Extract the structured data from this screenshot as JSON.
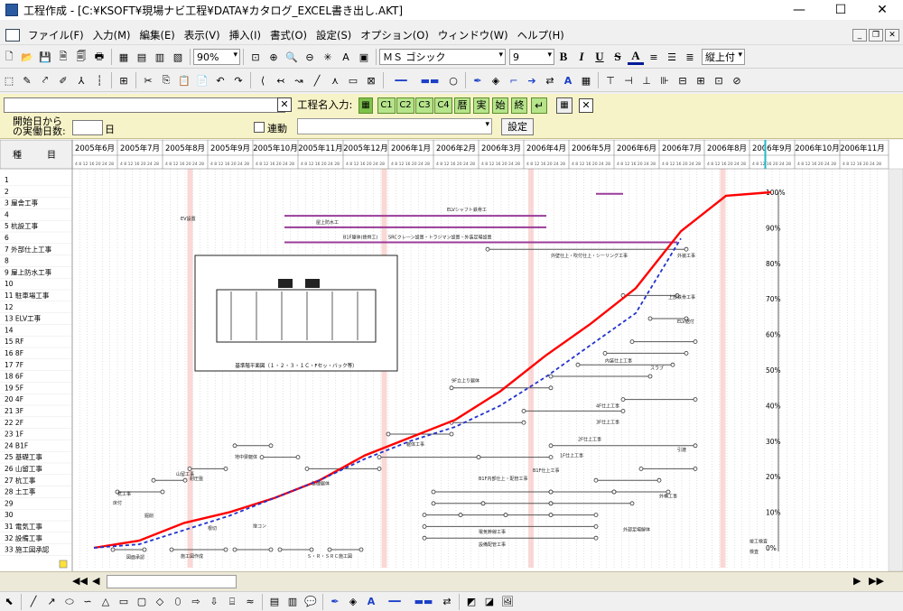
{
  "window": {
    "title": "工程作成 - [C:¥KSOFT¥現場ナビ工程¥DATA¥カタログ_EXCEL書き出し.AKT]",
    "min_icon": "minimize-icon",
    "max_icon": "maximize-icon",
    "close_icon": "close-icon"
  },
  "menu": {
    "items": [
      "ファイル(F)",
      "入力(M)",
      "編集(E)",
      "表示(V)",
      "挿入(I)",
      "書式(O)",
      "設定(S)",
      "オプション(O)",
      "ウィンドウ(W)",
      "ヘルプ(H)"
    ],
    "mdi_buttons": [
      "_",
      "❐",
      "✕"
    ]
  },
  "toolbar1": {
    "zoom": "90%",
    "font_name": "ＭＳ ゴシック",
    "font_size": "9",
    "bold": "B",
    "italic": "I",
    "underline": "U",
    "strike": "S",
    "font_color_glyph": "A",
    "vertical_align": "縦上付"
  },
  "panel": {
    "start_label_1": "開始日から",
    "start_label_2": "の実働日数:",
    "day_unit": "日",
    "link_label": "連動",
    "name_label": "工程名入力:",
    "code_buttons": [
      "C1",
      "C2",
      "C3",
      "C4"
    ],
    "cal_buttons": [
      "暦",
      "実",
      "始",
      "終"
    ],
    "set_button": "設定",
    "close_glyph": "✕",
    "enter_glyph": "↵"
  },
  "months": [
    "2005年6月",
    "2005年7月",
    "2005年8月",
    "2005年9月",
    "2005年10月",
    "2005年11月",
    "2005年12月",
    "2006年1月",
    "2006年2月",
    "2006年3月",
    "2006年4月",
    "2006年5月",
    "2006年6月",
    "2006年7月",
    "2006年8月",
    "2006年9月",
    "2006年10月",
    "2006年11月"
  ],
  "header": {
    "col_left": "種",
    "col_right": "目"
  },
  "rows": [
    "1",
    "2",
    "3 屋舎工事",
    "4",
    "5 杭設工事",
    "6",
    "7 外部仕上工事",
    "8",
    "9 屋上防水工事",
    "10",
    "11 駐車場工事",
    "12",
    "13 ELV工事",
    "14",
    "15 RF",
    "16 8F",
    "17 7F",
    "18 6F",
    "19 5F",
    "20 4F",
    "21 3F",
    "22 2F",
    "23 1F",
    "24 B1F",
    "25 基礎工事",
    "26 山留工事",
    "27 杭工事",
    "28 土工事",
    "29",
    "30",
    "31 電気工事",
    "32 設備工事",
    "33 施工図承認"
  ],
  "chart_data": {
    "type": "line",
    "title": "",
    "xlabel": "",
    "ylabel": "",
    "ylim": [
      0,
      100
    ],
    "y_ticks": [
      "0%",
      "10%",
      "20%",
      "30%",
      "40%",
      "50%",
      "60%",
      "70%",
      "80%",
      "90%",
      "100%"
    ],
    "x": [
      "2005年6月",
      "2005年7月",
      "2005年8月",
      "2005年9月",
      "2005年10月",
      "2005年11月",
      "2005年12月",
      "2006年1月",
      "2006年2月",
      "2006年3月",
      "2006年4月",
      "2006年5月",
      "2006年6月",
      "2006年7月",
      "2006年8月",
      "2006年9月"
    ],
    "series": [
      {
        "color": "#ff0000",
        "style": "solid",
        "values": [
          0,
          2,
          7,
          10,
          14,
          19,
          26,
          31,
          36,
          44,
          54,
          63,
          73,
          89,
          99,
          100
        ]
      },
      {
        "color": "#2233cc",
        "style": "dashed",
        "values": [
          0,
          1,
          5,
          9,
          14,
          19,
          25,
          30,
          34,
          40,
          48,
          57,
          66,
          87,
          null,
          null
        ]
      }
    ],
    "task_labels": [
      "ELVシャフト鉄骨工",
      "屋上防水工",
      "EV設置",
      "B1F躯体(鉄骨工)",
      "SRCクレーン設置・トラジマン設置・外装足場設置",
      "外壁仕上・吹付仕上・シーリング工事",
      "外装工事",
      "上部鉄骨工事",
      "ELV据付",
      "躯体工事",
      "9F立上り躯体",
      "内装仕上工事",
      "スラブ",
      "4F仕上工事",
      "3F仕上工事",
      "2F仕上工事",
      "1F仕上工事",
      "B1F仕上工事",
      "地中梁躯体",
      "耐圧盤",
      "B1F内部仕上・配管工事",
      "電気幹線工事",
      "設備配管工事",
      "外構工事",
      "検査",
      "外部足場解体",
      "山留工事",
      "杭工事",
      "床付",
      "掘削",
      "根切",
      "捨コン",
      "基礎躯体",
      "引渡",
      "竣工検査",
      "図面承認",
      "施工図作成",
      "Ｓ・Ｒ・ＳＲＣ施工図"
    ],
    "inset_caption": "基準階平面図（１・２・３・１Ｃ・Fセッ・バック等）"
  }
}
